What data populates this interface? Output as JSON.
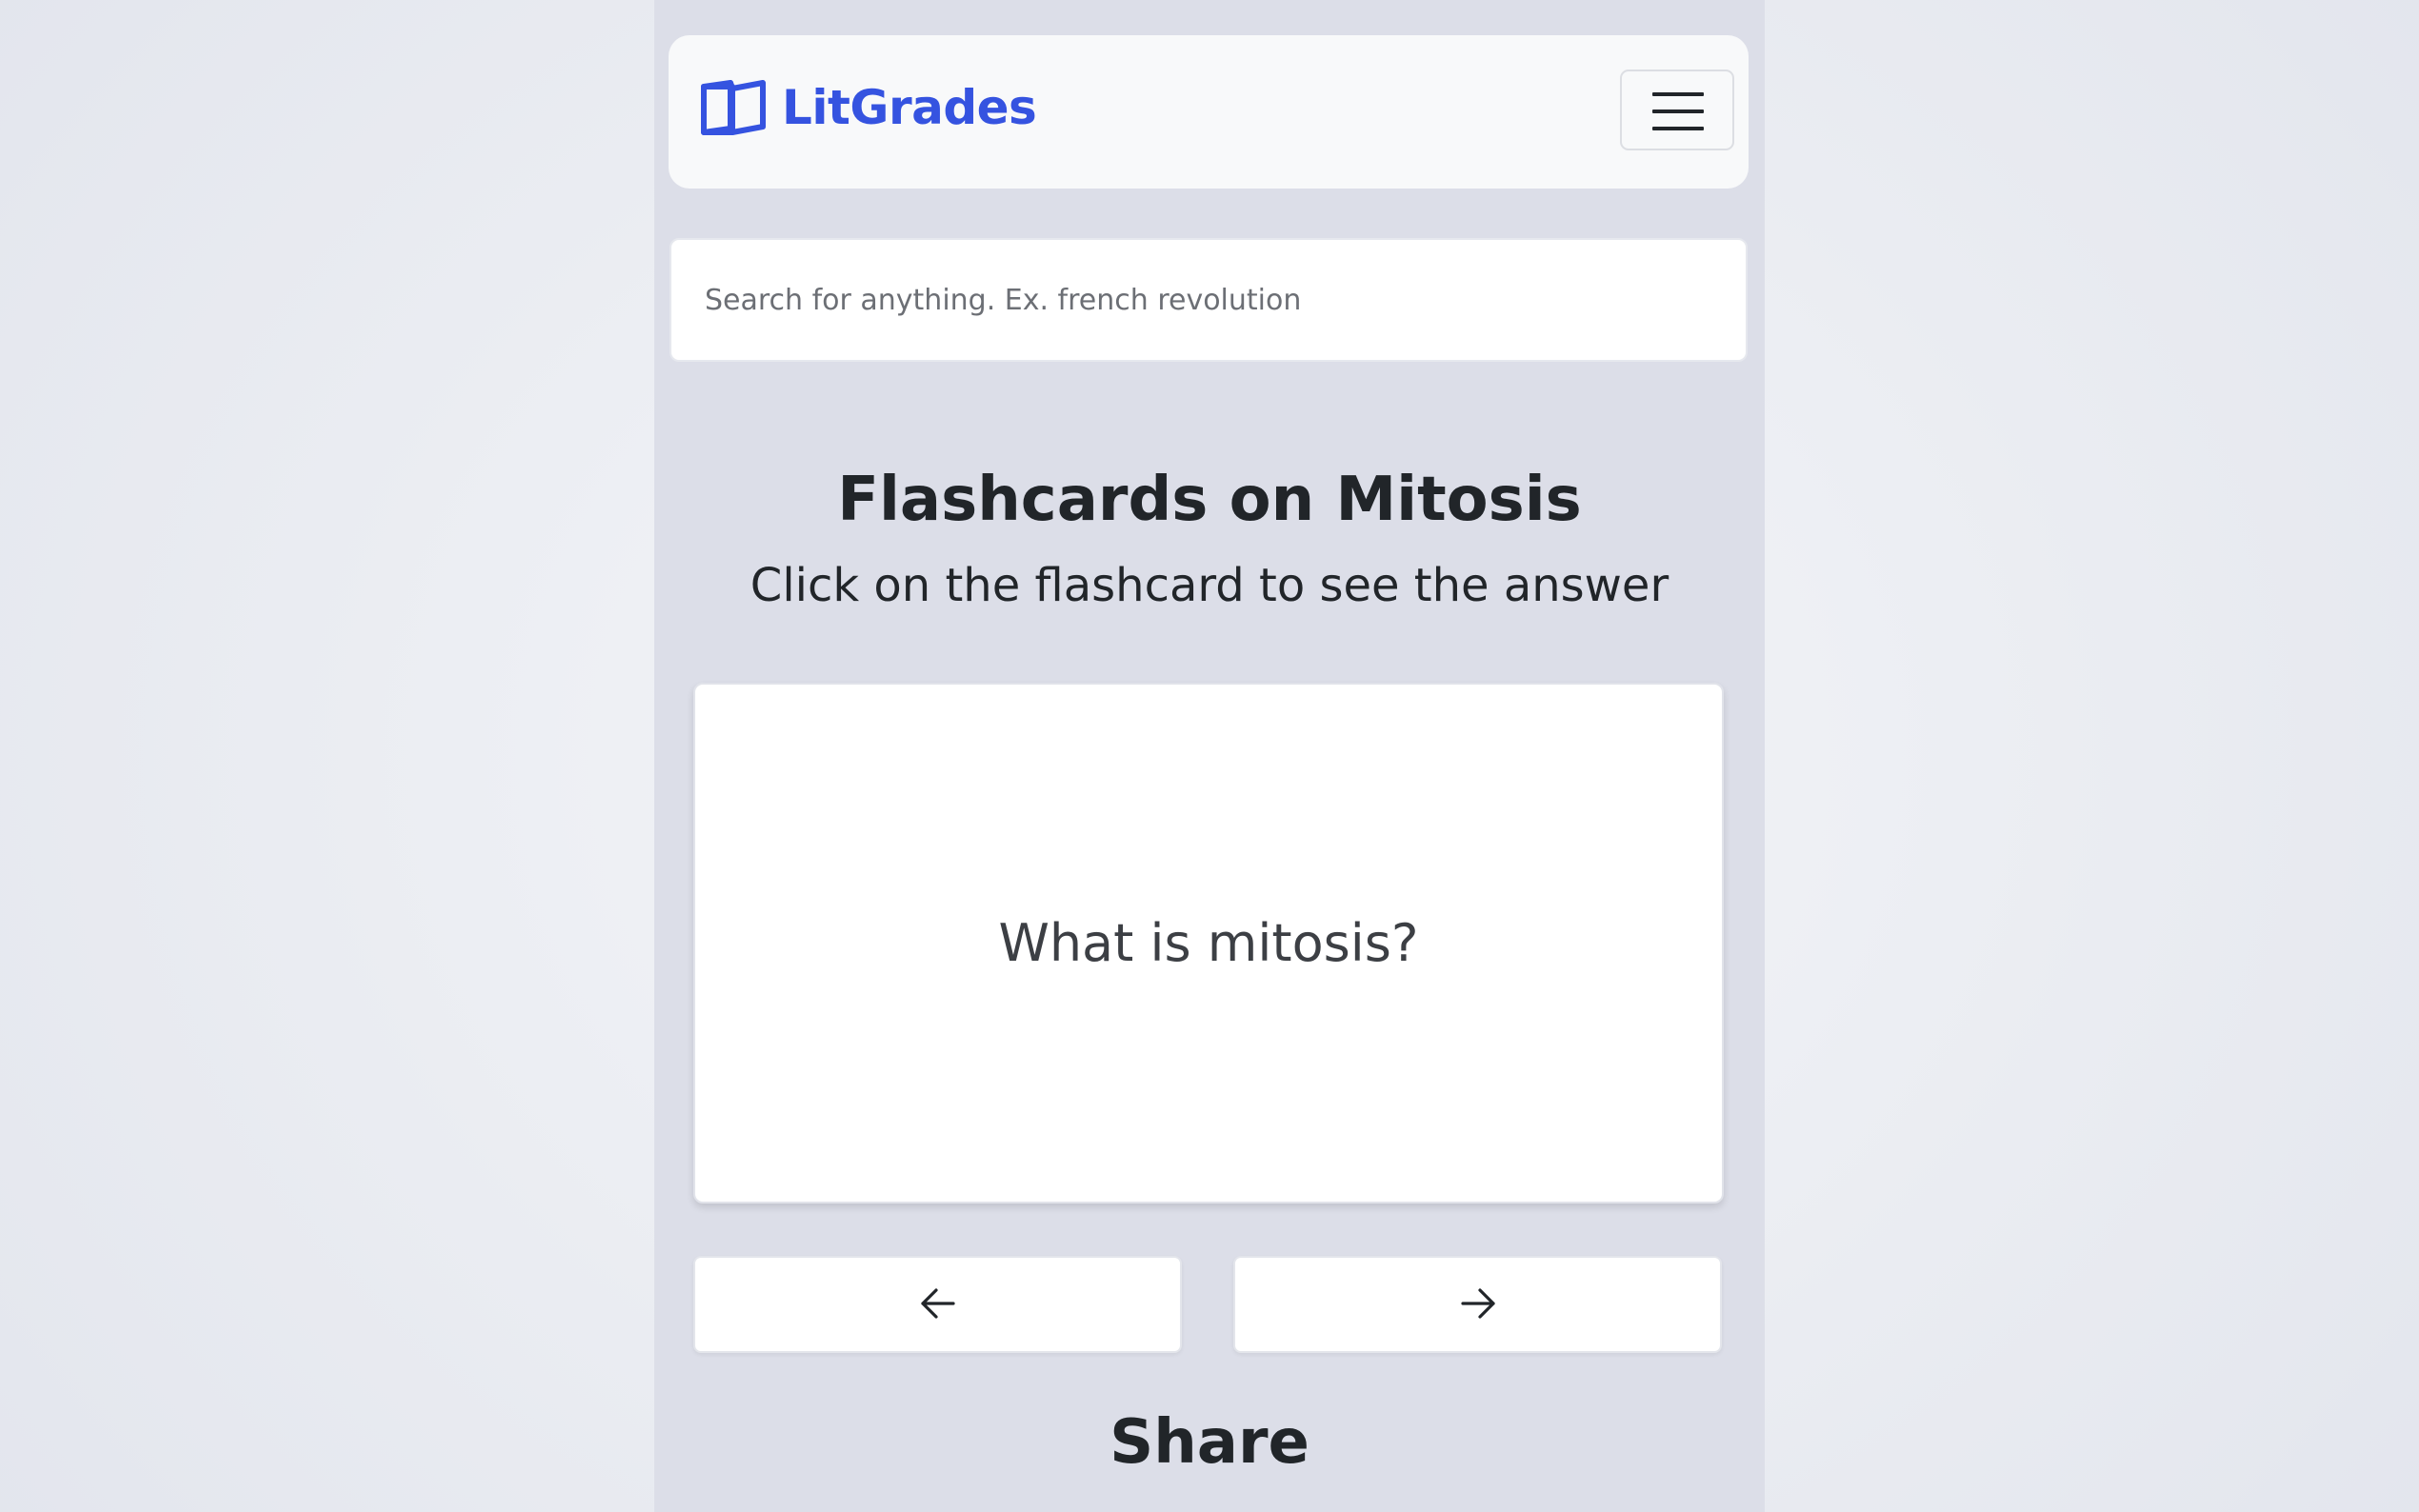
{
  "navbar": {
    "brand_name": "LitGrades",
    "brand_color": "#3553e0",
    "logo_icon": "open-book-icon",
    "menu_icon": "hamburger-menu-icon"
  },
  "search": {
    "placeholder": "Search for anything. Ex. french revolution",
    "value": ""
  },
  "main": {
    "title": "Flashcards on Mitosis",
    "subtitle": "Click on the flashcard to see the answer",
    "flashcard": {
      "question": "What is mitosis?"
    },
    "controls": {
      "prev_icon": "arrow-left-icon",
      "next_icon": "arrow-right-icon"
    }
  },
  "share": {
    "heading": "Share"
  }
}
